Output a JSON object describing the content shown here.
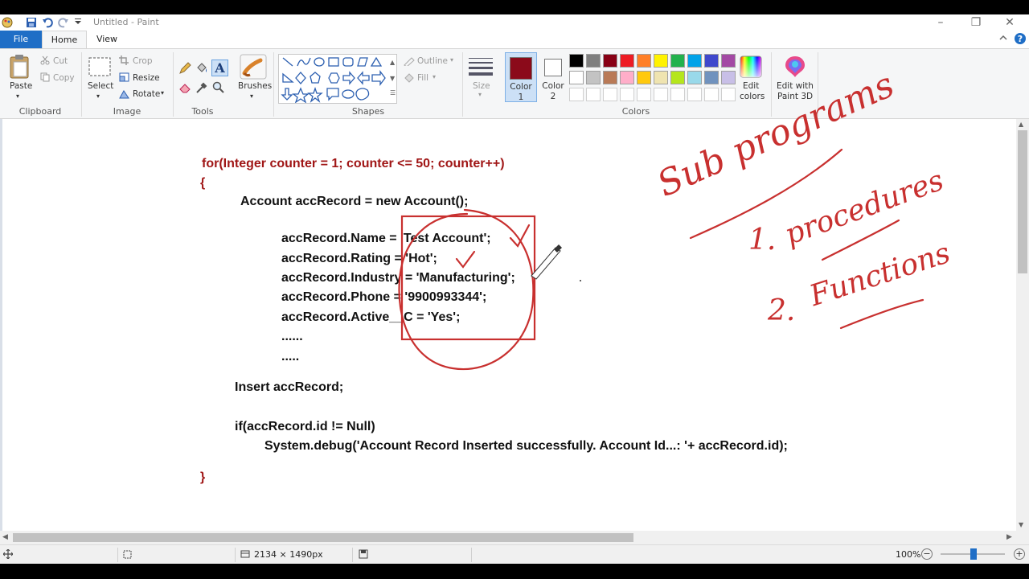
{
  "window": {
    "title": "Untitled - Paint",
    "controls": [
      "–",
      "❐",
      "✕"
    ]
  },
  "tabs": [
    {
      "label": "File"
    },
    {
      "label": "Home"
    },
    {
      "label": "View"
    }
  ],
  "ribbon": {
    "clipboard": {
      "paste": "Paste",
      "cut": "Cut",
      "copy": "Copy",
      "group": "Clipboard"
    },
    "image": {
      "select": "Select",
      "crop": "Crop",
      "resize": "Resize",
      "rotate": "Rotate",
      "group": "Image"
    },
    "tools": {
      "group": "Tools",
      "text_tool": "A"
    },
    "brushes": {
      "label": "Brushes"
    },
    "shapes": {
      "outline": "Outline",
      "fill": "Fill",
      "group": "Shapes"
    },
    "size": {
      "label": "Size"
    },
    "color1": {
      "label": "Color",
      "num": "1",
      "value": "#8b0a1a"
    },
    "color2": {
      "label": "Color",
      "num": "2",
      "value": "#ffffff"
    },
    "colors": {
      "group": "Colors",
      "row1": [
        "#000000",
        "#7f7f7f",
        "#880015",
        "#ed1c24",
        "#ff7f27",
        "#fff200",
        "#22b14c",
        "#00a2e8",
        "#3f48cc",
        "#a349a4"
      ],
      "row2": [
        "#ffffff",
        "#c3c3c3",
        "#b97a57",
        "#ffaec9",
        "#ffc90e",
        "#efe4b0",
        "#b5e61d",
        "#99d9ea",
        "#7092be",
        "#c8bfe7"
      ]
    },
    "edit_colors": {
      "line1": "Edit",
      "line2": "colors"
    },
    "paint3d": {
      "line1": "Edit with",
      "line2": "Paint 3D"
    }
  },
  "canvas": {
    "code_lines": [
      {
        "text": "for(Integer counter = 1; counter <= 50; counter++)",
        "red": true
      },
      {
        "text": "{",
        "red": true
      },
      {
        "text": "Account accRecord = new Account();",
        "red": false
      },
      {
        "text": "accRecord.Name = 'Test Account';",
        "red": false
      },
      {
        "text": "accRecord.Rating = 'Hot';",
        "red": false
      },
      {
        "text": "accRecord.Industry = 'Manufacturing';",
        "red": false
      },
      {
        "text": "accRecord.Phone = '9900993344';",
        "red": false
      },
      {
        "text": "accRecord.Active__C = 'Yes';",
        "red": false
      },
      {
        "text": "......",
        "red": false
      },
      {
        "text": ".....",
        "red": false
      },
      {
        "text": "Insert accRecord;",
        "red": false
      },
      {
        "text": "if(accRecord.id != Null)",
        "red": false
      },
      {
        "text": "System.debug('Account Record Inserted successfully. Account Id...: '+ accRecord.id);",
        "red": false
      },
      {
        "text": "}",
        "red": true
      }
    ],
    "handwriting": {
      "title": "Sub programs",
      "item1_num": "1.",
      "item1": "procedures",
      "item2_num": "2.",
      "item2": "Functions"
    }
  },
  "status": {
    "dimensions": "2134 × 1490px",
    "zoom": "100%",
    "zoom_minus": "−",
    "zoom_plus": "+"
  }
}
